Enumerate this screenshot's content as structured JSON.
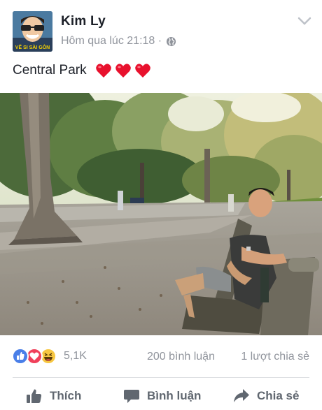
{
  "post": {
    "author": "Kim Ly",
    "timestamp": "Hôm qua lúc 21:18 ·",
    "avatar_text": "VẼ SI SÀI GÒN",
    "caption": "Central Park",
    "caption_hearts": 3
  },
  "stats": {
    "reactions": [
      "like",
      "love",
      "haha"
    ],
    "reaction_count": "5,1K",
    "comments": "200 bình luận",
    "shares": "1 lượt chia sẻ"
  },
  "actions": {
    "like_label": "Thích",
    "comment_label": "Bình luận",
    "share_label": "Chia sẻ"
  },
  "colors": {
    "like_blue": "#4a7fe8",
    "love_red": "#f0405a",
    "haha_yellow": "#f7c742",
    "heart_red": "#e8112d",
    "meta_gray": "#90949c",
    "action_gray": "#606770"
  }
}
